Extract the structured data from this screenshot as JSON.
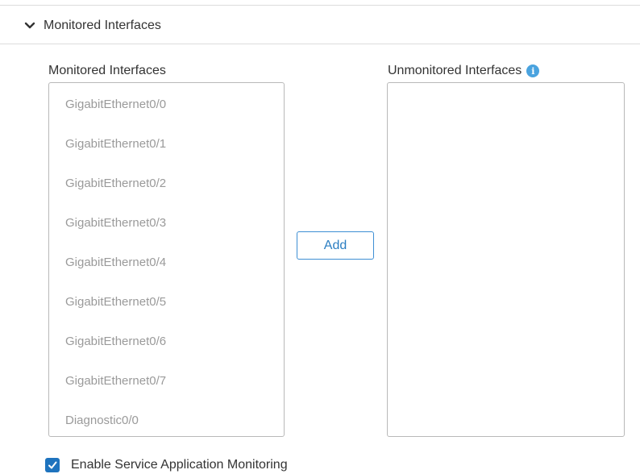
{
  "section": {
    "title": "Monitored Interfaces",
    "expanded_icon": "chevron-down-icon"
  },
  "monitored": {
    "label": "Monitored Interfaces",
    "items": [
      "GigabitEthernet0/0",
      "GigabitEthernet0/1",
      "GigabitEthernet0/2",
      "GigabitEthernet0/3",
      "GigabitEthernet0/4",
      "GigabitEthernet0/5",
      "GigabitEthernet0/6",
      "GigabitEthernet0/7",
      "Diagnostic0/0"
    ]
  },
  "unmonitored": {
    "label": "Unmonitored Interfaces",
    "info_icon": "info-icon",
    "items": []
  },
  "add_button": {
    "label": "Add"
  },
  "service_monitoring": {
    "label": "Enable Service Application Monitoring",
    "checked": true
  },
  "colors": {
    "accent": "#1e73be",
    "info": "#4aa3df",
    "muted_text": "#9a9a9a",
    "border": "#b9b9b9"
  }
}
